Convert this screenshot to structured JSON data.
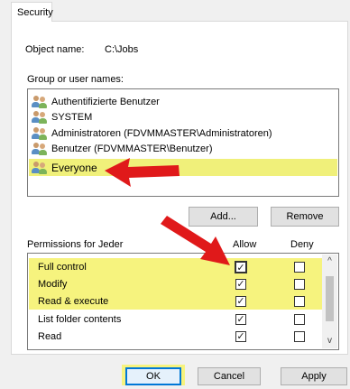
{
  "tab": {
    "security_label": "Security"
  },
  "object": {
    "label": "Object name:",
    "value": "C:\\Jobs"
  },
  "groups": {
    "label": "Group or user names:",
    "items": [
      {
        "name": "Authentifizierte Benutzer",
        "selected": false
      },
      {
        "name": "SYSTEM",
        "selected": false
      },
      {
        "name": "Administratoren (FDVMMASTER\\Administratoren)",
        "selected": false
      },
      {
        "name": "Benutzer (FDVMMASTER\\Benutzer)",
        "selected": false
      },
      {
        "name": "Everyone",
        "selected": true
      }
    ]
  },
  "buttons": {
    "add": "Add...",
    "remove": "Remove",
    "ok": "OK",
    "cancel": "Cancel",
    "apply": "Apply"
  },
  "permissions": {
    "label": "Permissions for Jeder",
    "allow_header": "Allow",
    "deny_header": "Deny",
    "rows": [
      {
        "name": "Full control",
        "allow": true,
        "deny": false,
        "highlighted": true
      },
      {
        "name": "Modify",
        "allow": true,
        "deny": false,
        "highlighted": true
      },
      {
        "name": "Read & execute",
        "allow": true,
        "deny": false,
        "highlighted": true
      },
      {
        "name": "List folder contents",
        "allow": true,
        "deny": false,
        "highlighted": false
      },
      {
        "name": "Read",
        "allow": true,
        "deny": false,
        "highlighted": false
      }
    ]
  },
  "colors": {
    "highlight": "#f6f37e",
    "arrow": "#e0191a",
    "selection": "#f0f07a"
  },
  "icons": {
    "user": "users-group-icon",
    "arrow": "red-arrow-icon",
    "check": "checkmark-icon"
  }
}
